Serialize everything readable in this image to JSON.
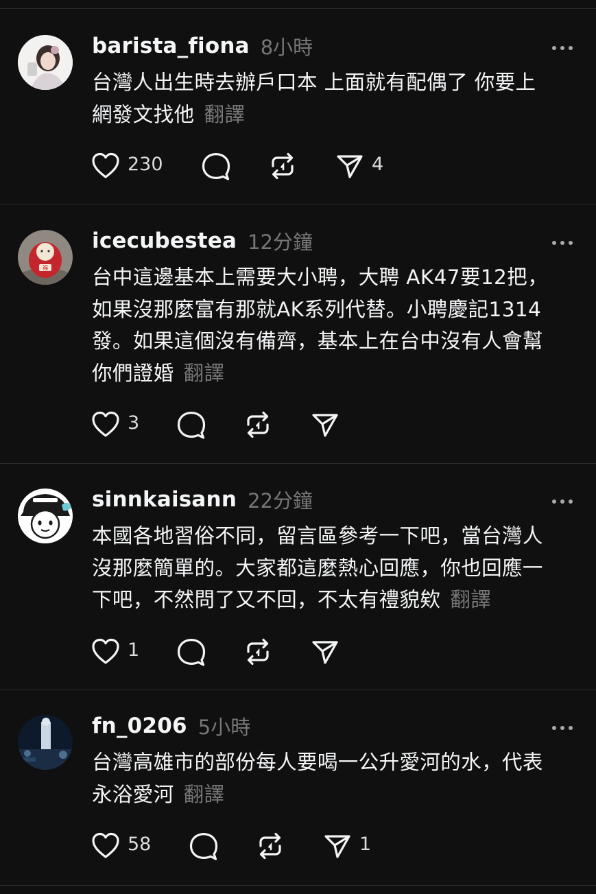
{
  "posts": [
    {
      "username": "barista_fiona",
      "time": "8小時",
      "lines": [
        "台灣人出生時去辦戶口本 上面就有配偶了 你要上",
        "網發文找他"
      ],
      "translate_label": "翻譯",
      "likes": "230",
      "replies": "",
      "reposts": "",
      "shares": "4"
    },
    {
      "username": "icecubestea",
      "time": "12分鐘",
      "lines": [
        "台中這邊基本上需要大小聘，大聘 AK47要12把，",
        "如果沒那麼富有那就AK系列代替。小聘慶記1314",
        "發。如果這個沒有備齊，基本上在台中沒有人會幫",
        "你們證婚"
      ],
      "translate_label": "翻譯",
      "likes": "3",
      "replies": "",
      "reposts": "",
      "shares": ""
    },
    {
      "username": "sinnkaisann",
      "time": "22分鐘",
      "lines": [
        "本國各地習俗不同，留言區參考一下吧，當台灣人",
        "沒那麼簡單的。大家都這麼熱心回應，你也回應一",
        "下吧，不然問了又不回，不太有禮貌欸"
      ],
      "translate_label": "翻譯",
      "likes": "1",
      "replies": "",
      "reposts": "",
      "shares": ""
    },
    {
      "username": "fn_0206",
      "time": "5小時",
      "lines": [
        "台灣高雄市的部份每人要喝一公升愛河的水，代表",
        "永浴愛河"
      ],
      "translate_label": "翻譯",
      "likes": "58",
      "replies": "",
      "reposts": "",
      "shares": "1"
    }
  ],
  "icons": {
    "like": "heart-icon",
    "reply": "comment-bubble-icon",
    "repost": "repost-icon",
    "share": "send-icon",
    "more": "more-dots-icon"
  },
  "colors": {
    "background": "#101010",
    "text": "#f3f5f7",
    "muted": "#777777",
    "divider": "#2a2a2a"
  }
}
